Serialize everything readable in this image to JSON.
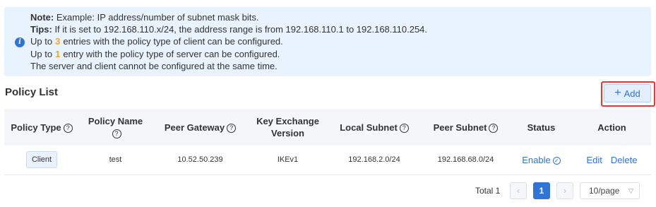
{
  "notice": {
    "note_label": "Note:",
    "note_text": " Example: IP address/number of subnet mask bits.",
    "tips_label": "Tips:",
    "tips_text": " If it is set to 192.168.110.x/24, the address range is from 192.168.110.1 to 192.168.110.254.",
    "client_prefix": "Up to",
    "client_count": "3",
    "client_suffix": "entries with the policy type of client can be configured.",
    "server_prefix": "Up to",
    "server_count": "1",
    "server_suffix": "entry with the policy type of server can be configured.",
    "exclusive_text": "The server and client cannot be configured at the same time.",
    "icon": "info-icon"
  },
  "section": {
    "title": "Policy List"
  },
  "toolbar": {
    "add_label": "Add",
    "add_icon": "plus-icon"
  },
  "table": {
    "headers": {
      "policy_type": "Policy Type",
      "policy_name": "Policy Name",
      "peer_gateway": "Peer Gateway",
      "key_exchange": "Key Exchange Version",
      "local_subnet": "Local Subnet",
      "peer_subnet": "Peer Subnet",
      "status": "Status",
      "action": "Action"
    },
    "help_glyph": "?",
    "rows": [
      {
        "policy_type": "Client",
        "policy_name": "test",
        "peer_gateway": "10.52.50.239",
        "key_exchange": "IKEv1",
        "local_subnet": "192.168.2.0/24",
        "peer_subnet": "192.168.68.0/24",
        "status": "Enable",
        "edit": "Edit",
        "delete": "Delete"
      }
    ]
  },
  "pagination": {
    "total": "Total 1",
    "current_page": "1",
    "page_size": "10/page",
    "prev_glyph": "‹",
    "next_glyph": "›"
  },
  "colors": {
    "accent": "#2f74d6",
    "notice_bg": "#e8f3fd",
    "count": "#f5a623",
    "highlight": "#e53935"
  }
}
